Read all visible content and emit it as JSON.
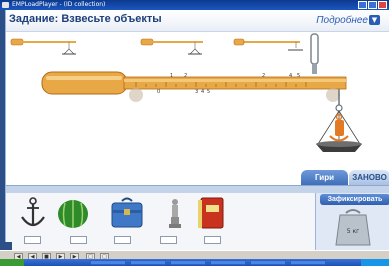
{
  "window": {
    "title": "EMPLoadPlayer - (ID collection)"
  },
  "header": {
    "task_title": "Задание: Взвесьте объекты",
    "more_label": "Подробнее",
    "more_icon": "chevron-down-icon"
  },
  "ruler": {
    "ticks_top": [
      "1",
      "2",
      "2",
      "4",
      "5"
    ],
    "ticks_bottom": [
      "0",
      "3",
      "4",
      "5"
    ]
  },
  "tabs": {
    "weights": "Гири",
    "reset": "ЗАНОВО"
  },
  "fix_panel": {
    "button": "Зафиксировать",
    "weight_label": "5 кг"
  },
  "tray": {
    "items": [
      {
        "name": "anchor",
        "icon": "anchor-icon"
      },
      {
        "name": "watermelon",
        "icon": "watermelon-icon"
      },
      {
        "name": "briefcase",
        "icon": "briefcase-icon"
      },
      {
        "name": "statuette",
        "icon": "statuette-icon"
      },
      {
        "name": "book",
        "icon": "book-icon"
      }
    ]
  },
  "colors": {
    "accent": "#2a5db4",
    "beam": "#e8a845",
    "beam_dark": "#b56a18",
    "tab_active": "#3f6fba"
  }
}
